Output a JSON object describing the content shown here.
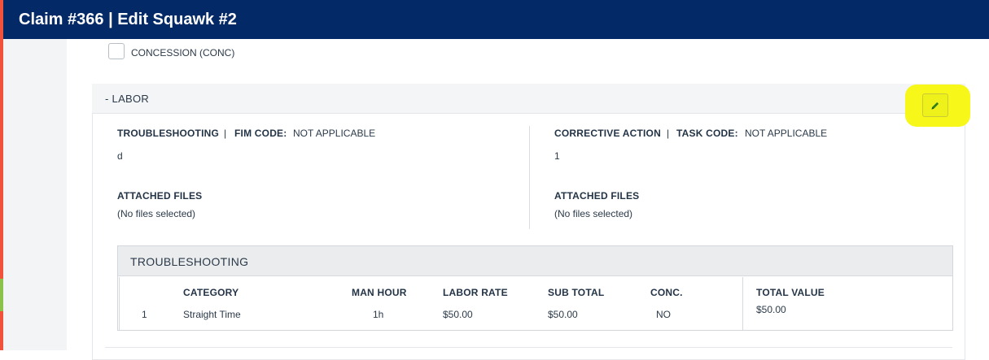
{
  "header": {
    "title": "Claim #366 | Edit Squawk #2"
  },
  "concession": {
    "label": "CONCESSION (CONC)",
    "checked": false
  },
  "labor": {
    "title": "- LABOR",
    "edit_icon": "pencil-icon",
    "troubleshooting": {
      "heading": "TROUBLESHOOTING",
      "separator": "|",
      "code_label": "FIM CODE:",
      "code_value": "NOT APPLICABLE",
      "text": "d",
      "files_label": "ATTACHED FILES",
      "files_value": "(No files selected)"
    },
    "corrective_action": {
      "heading": "CORRECTIVE ACTION",
      "separator": "|",
      "code_label": "TASK CODE:",
      "code_value": "NOT APPLICABLE",
      "text": "1",
      "files_label": "ATTACHED FILES",
      "files_value": "(No files selected)"
    },
    "table": {
      "title": "TROUBLESHOOTING",
      "columns": [
        "CATEGORY",
        "MAN HOUR",
        "LABOR RATE",
        "SUB TOTAL",
        "CONC."
      ],
      "rows": [
        {
          "index": "1",
          "category": "Straight Time",
          "man_hour": "1h",
          "labor_rate": "$50.00",
          "sub_total": "$50.00",
          "conc": "NO"
        }
      ],
      "total_label": "TOTAL VALUE",
      "total_value": "$50.00"
    }
  },
  "colors": {
    "header_bg": "#032a66",
    "highlight": "#f7f71a",
    "accent_left": "#f0523c",
    "accent_green": "#8bc34a"
  }
}
